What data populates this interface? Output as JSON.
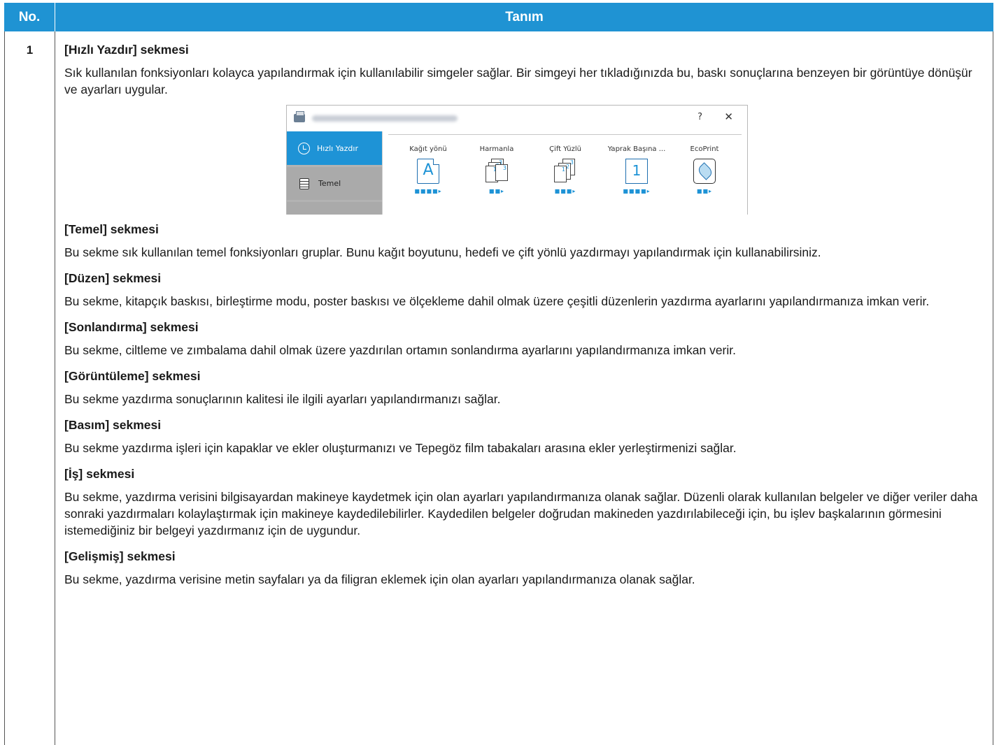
{
  "header": {
    "no": "No.",
    "definition": "Tanım"
  },
  "row": {
    "no": "1",
    "sections": [
      {
        "title": "[Hızlı Yazdır] sekmesi",
        "paragraphs": [
          "Sık kullanılan fonksiyonları kolayca yapılandırmak için kullanılabilir simgeler sağlar. Bir simgeyi her tıkladığınızda bu, baskı sonuçlarına benzeyen bir görüntüye dönüşür ve ayarları uygular."
        ]
      },
      {
        "title": "[Temel] sekmesi",
        "paragraphs": [
          "Bu sekme sık kullanılan temel fonksiyonları gruplar. Bunu kağıt boyutunu, hedefi ve çift yönlü yazdırmayı yapılandırmak için kullanabilirsiniz."
        ]
      },
      {
        "title": "[Düzen] sekmesi",
        "paragraphs": [
          "Bu sekme, kitapçık baskısı, birleştirme modu, poster baskısı ve ölçekleme dahil olmak üzere çeşitli düzenlerin yazdırma ayarlarını yapılandırmanıza imkan verir."
        ]
      },
      {
        "title": "[Sonlandırma] sekmesi",
        "paragraphs": [
          "Bu sekme, ciltleme ve zımbalama dahil olmak üzere yazdırılan ortamın sonlandırma ayarlarını yapılandırmanıza imkan verir."
        ]
      },
      {
        "title": "[Görüntüleme] sekmesi",
        "paragraphs": [
          "Bu sekme yazdırma sonuçlarının kalitesi ile ilgili ayarları yapılandırmanızı sağlar."
        ]
      },
      {
        "title": "[Basım] sekmesi",
        "paragraphs": [
          "Bu sekme yazdırma işleri için kapaklar ve ekler oluşturmanızı ve Tepegöz film tabakaları arasına ekler yerleştirmenizi sağlar."
        ]
      },
      {
        "title": "[İş] sekmesi",
        "paragraphs": [
          "Bu sekme, yazdırma verisini bilgisayardan makineye kaydetmek için olan ayarları yapılandırmanıza olanak sağlar. Düzenli olarak kullanılan belgeler ve diğer veriler daha sonraki yazdırmaları kolaylaştırmak için makineye kaydedilebilirler. Kaydedilen belgeler doğrudan makineden yazdırılabileceği için, bu işlev başkalarının görmesini istemediğiniz bir belgeyi yazdırmanız için de uygundur."
        ]
      },
      {
        "title": "[Gelişmiş] sekmesi",
        "paragraphs": [
          "Bu sekme, yazdırma verisine metin sayfaları ya da filigran eklemek için olan ayarları yapılandırmanıza olanak sağlar."
        ]
      }
    ]
  },
  "screenshot": {
    "help": "?",
    "close": "✕",
    "sidebar": [
      {
        "label": "Hızlı Yazdır",
        "icon": "clock-icon",
        "active": true
      },
      {
        "label": "Temel",
        "icon": "document-icon",
        "active": false
      }
    ],
    "items": [
      {
        "label": "Kağıt yönü",
        "icon": "portrait-page-icon",
        "glyph": "A",
        "dots": "■■■■▸"
      },
      {
        "label": "Harmanla",
        "icon": "collate-icon",
        "dots": "■■▸"
      },
      {
        "label": "Çift Yüzlü",
        "icon": "duplex-icon",
        "dots": "■■■▸"
      },
      {
        "label": "Yaprak Başına ...",
        "icon": "pages-per-sheet-icon",
        "glyph": "1",
        "dots": "■■■■▸"
      },
      {
        "label": "EcoPrint",
        "icon": "leaf-icon",
        "dots": "■■▸"
      }
    ],
    "accent_color": "#1e93d6"
  },
  "colors": {
    "header_bg": "#1f93d3",
    "header_text": "#ffffff"
  }
}
